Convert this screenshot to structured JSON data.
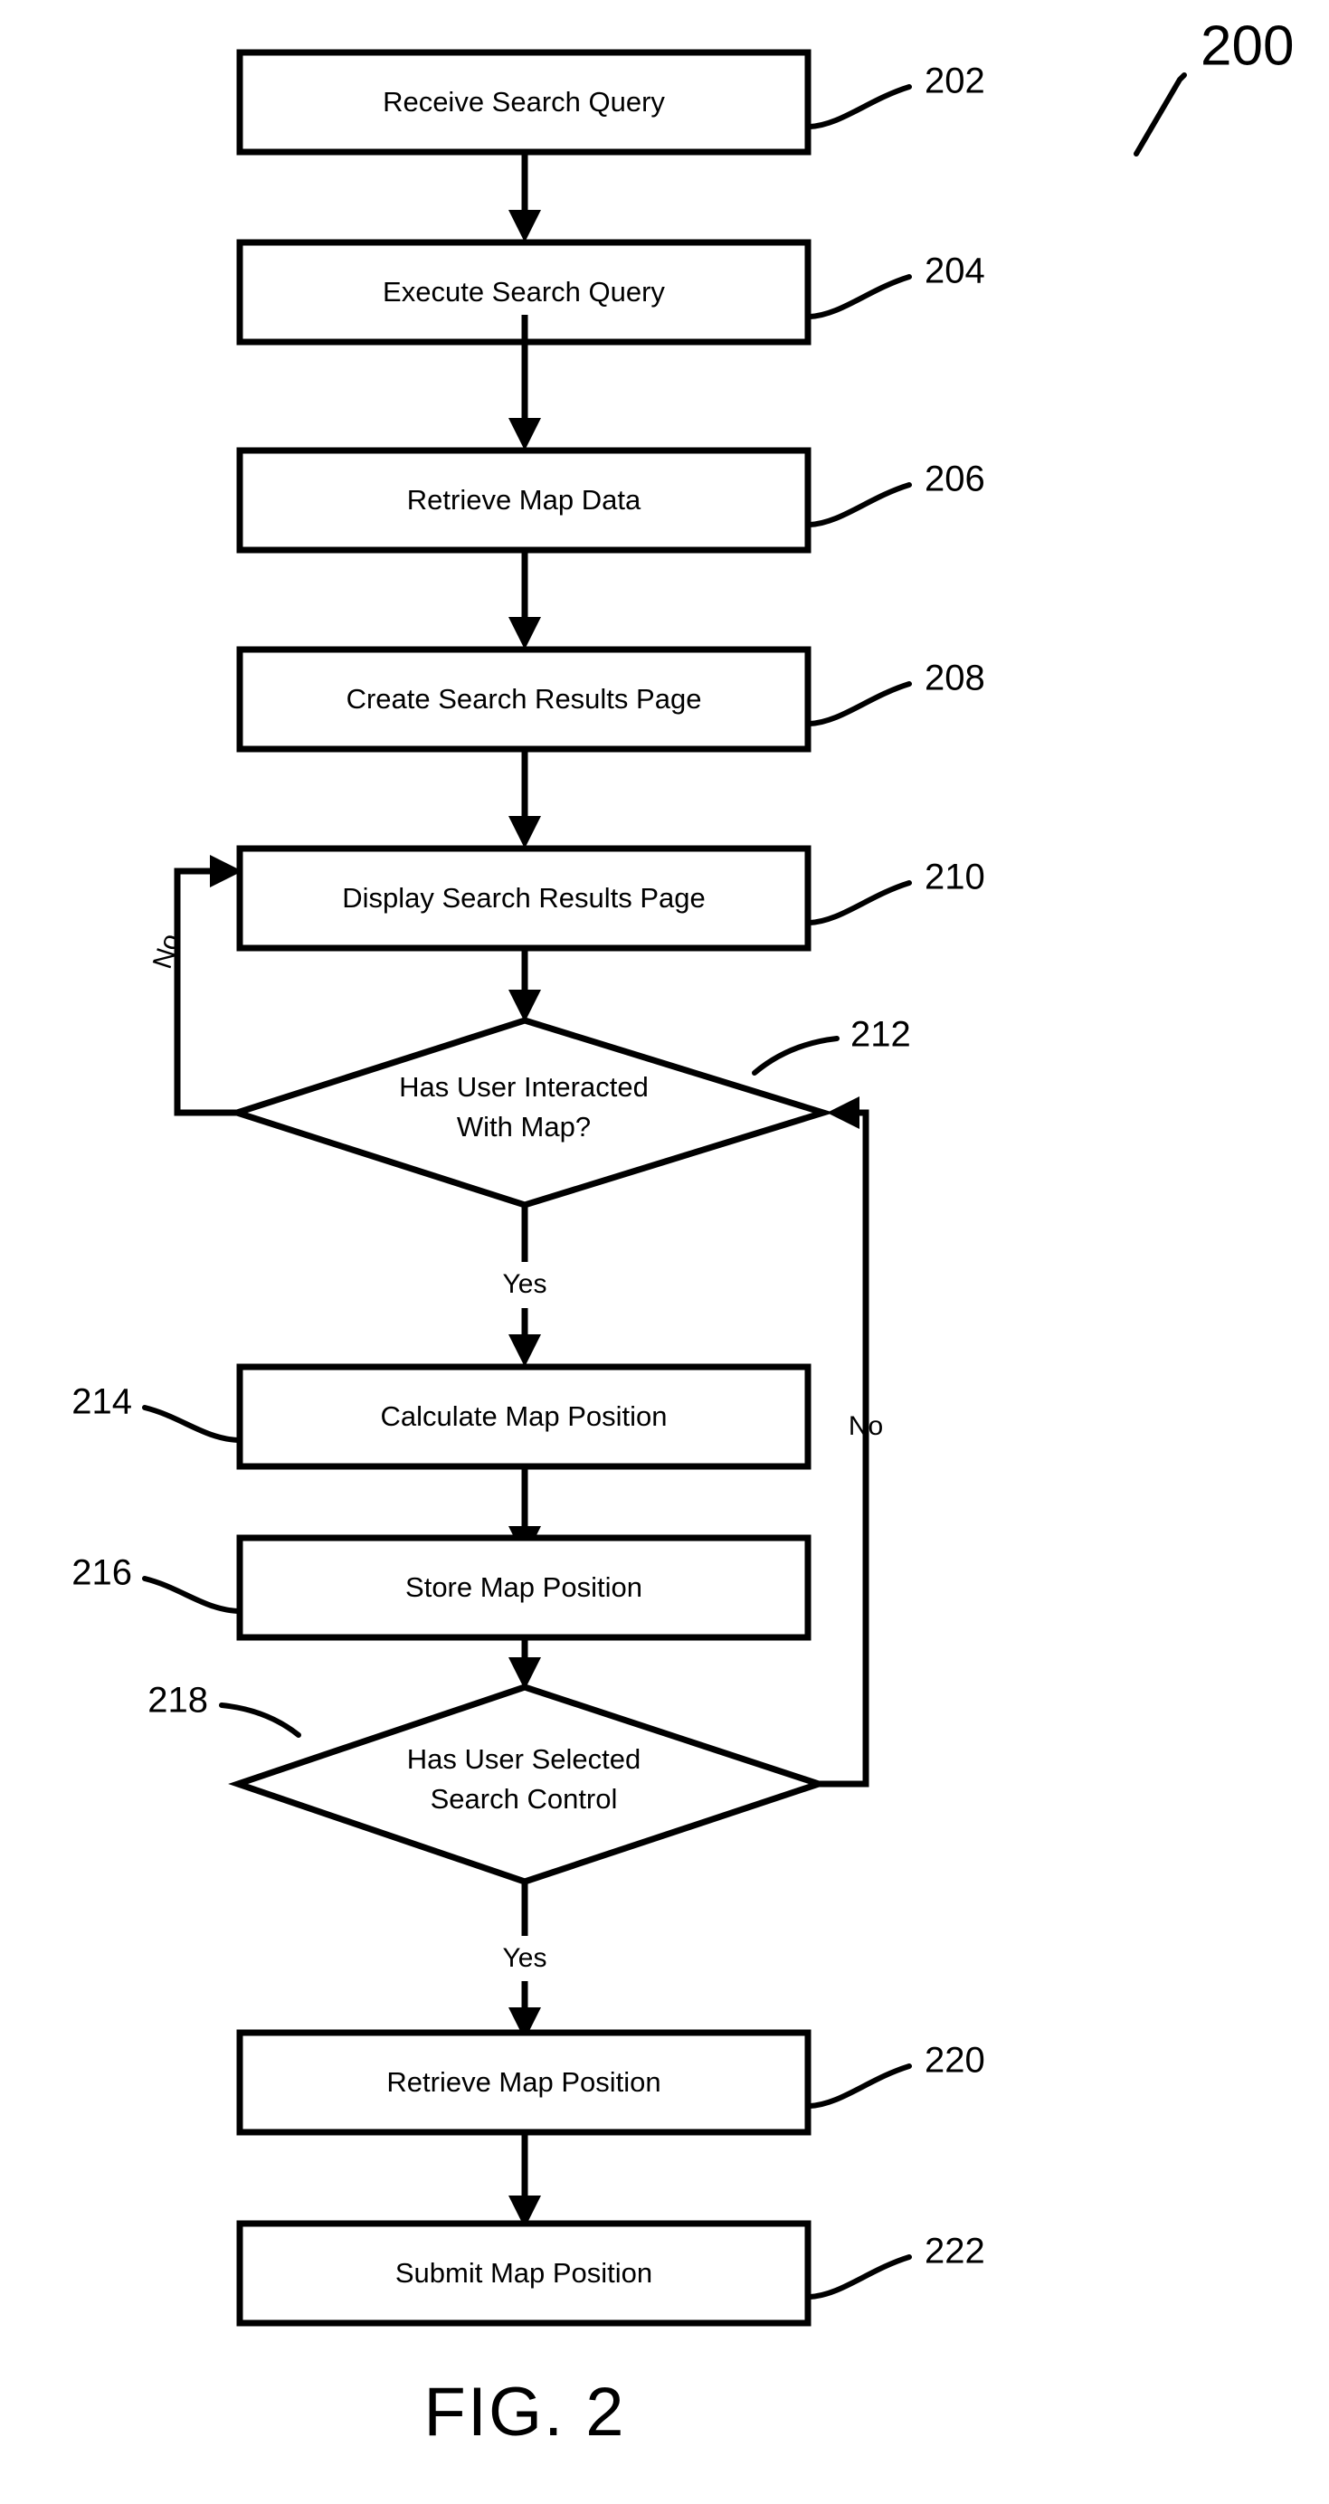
{
  "figure": {
    "caption": "FIG. 2",
    "figure_ref": "200"
  },
  "branch_labels": {
    "no_left": "No",
    "yes_top": "Yes",
    "no_right": "No",
    "yes_bottom": "Yes"
  },
  "nodes": [
    {
      "id": "n202",
      "shape": "process",
      "label": "Receive Search Query",
      "ref": "202",
      "ref_side": "right"
    },
    {
      "id": "n204",
      "shape": "process",
      "label": "Execute Search Query",
      "ref": "204",
      "ref_side": "right"
    },
    {
      "id": "n206",
      "shape": "process",
      "label": "Retrieve Map Data",
      "ref": "206",
      "ref_side": "right"
    },
    {
      "id": "n208",
      "shape": "process",
      "label": "Create Search Results Page",
      "ref": "208",
      "ref_side": "right"
    },
    {
      "id": "n210",
      "shape": "process",
      "label": "Display Search Results Page",
      "ref": "210",
      "ref_side": "right"
    },
    {
      "id": "n212",
      "shape": "decision",
      "label_line1": "Has User Interacted",
      "label_line2": "With Map?",
      "ref": "212",
      "ref_side": "right"
    },
    {
      "id": "n214",
      "shape": "process",
      "label": "Calculate Map Position",
      "ref": "214",
      "ref_side": "left"
    },
    {
      "id": "n216",
      "shape": "process",
      "label": "Store Map Position",
      "ref": "216",
      "ref_side": "left"
    },
    {
      "id": "n218",
      "shape": "decision",
      "label_line1": "Has User Selected",
      "label_line2": "Search Control",
      "ref": "218",
      "ref_side": "left"
    },
    {
      "id": "n220",
      "shape": "process",
      "label": "Retrieve Map Position",
      "ref": "220",
      "ref_side": "right"
    },
    {
      "id": "n222",
      "shape": "process",
      "label": "Submit Map Position",
      "ref": "222",
      "ref_side": "right"
    }
  ],
  "colors": {
    "stroke": "#000000",
    "fill": "#ffffff",
    "background": "#ffffff"
  }
}
